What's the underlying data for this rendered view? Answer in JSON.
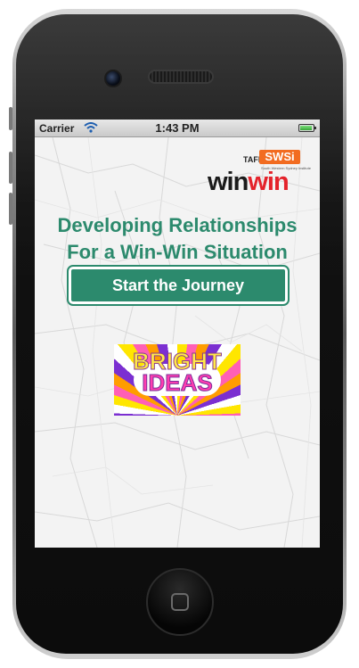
{
  "status_bar": {
    "carrier": "Carrier",
    "time": "1:43 PM",
    "wifi_icon": "wifi-icon",
    "battery_icon": "battery-icon"
  },
  "logo": {
    "tafe": "TAFE",
    "swsi": "SWSi",
    "swsi_subtitle": "South Western Sydney Institute",
    "win_black": "win",
    "win_red": "win"
  },
  "headline": {
    "line1": "Developing Relationships",
    "line2": "For a Win-Win Situation"
  },
  "start_button": {
    "label": "Start the Journey"
  },
  "bright_ideas": {
    "line1": "BRIGHT",
    "line2": "IDEAS"
  },
  "colors": {
    "accent_green": "#2c8a6d",
    "brand_orange": "#f26c21",
    "brand_red": "#e4232b"
  }
}
